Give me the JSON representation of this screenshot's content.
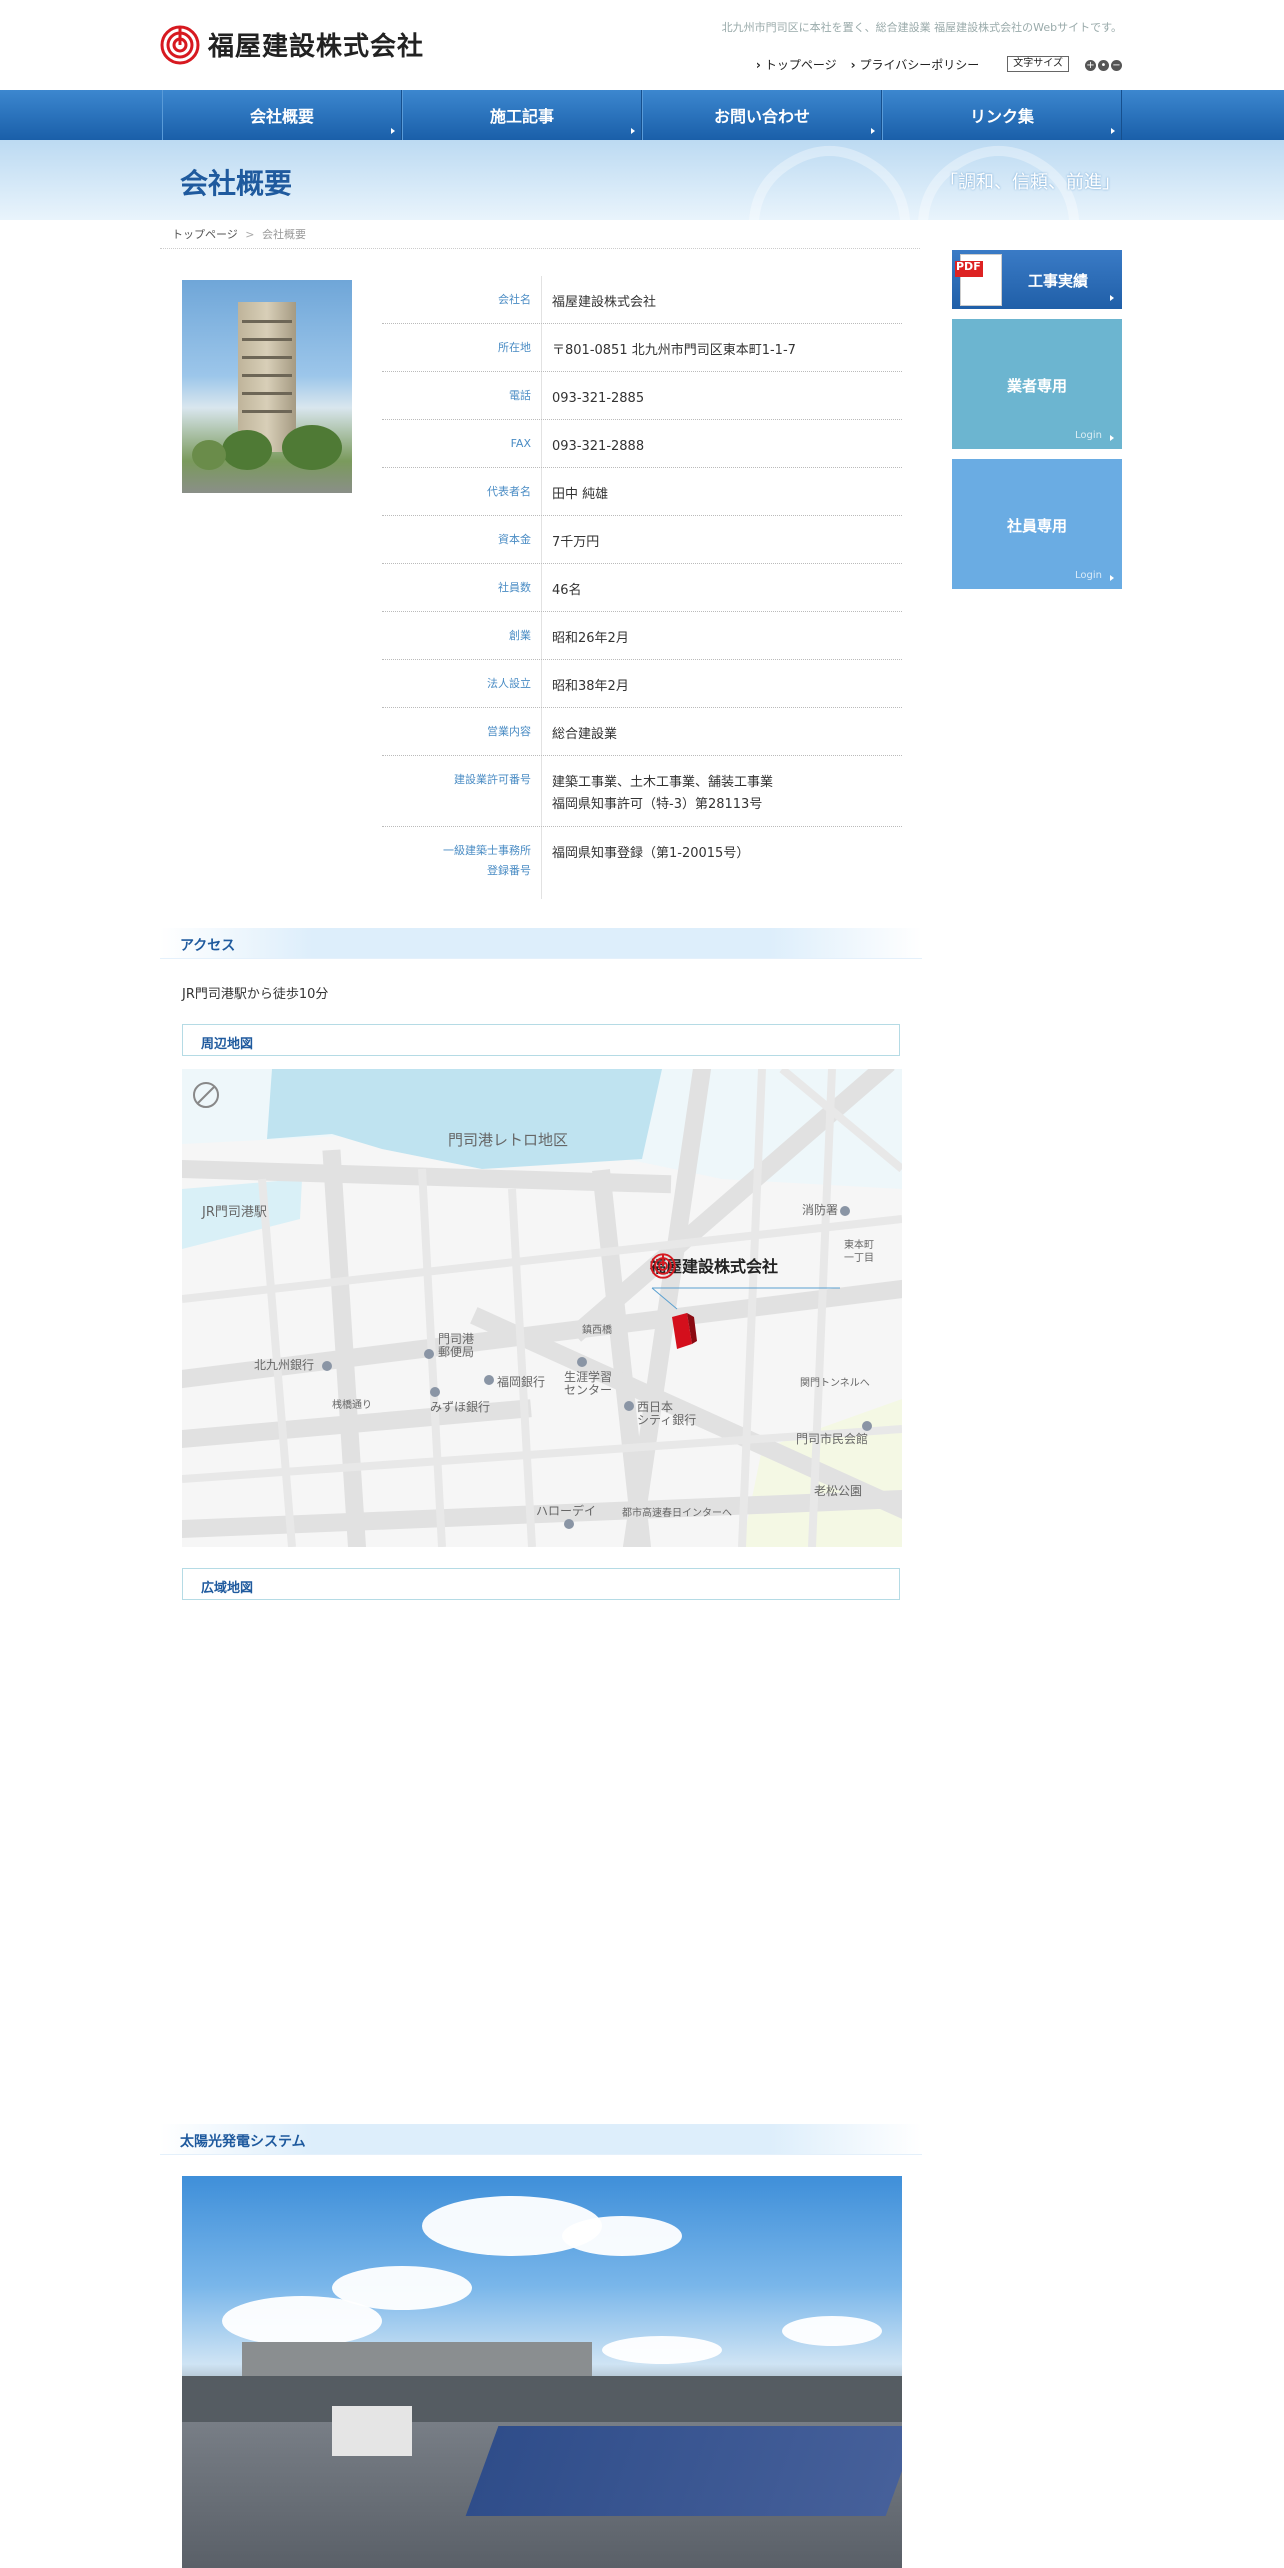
{
  "header": {
    "company_name": "福屋建設株式会社",
    "tagline": "北九州市門司区に本社を置く、総合建設業 福屋建設株式会社のWebサイトです。",
    "util_links": {
      "top": "トップページ",
      "privacy": "プライバシーポリシー"
    },
    "font_size_label": "文字サイズ",
    "font_size_controls": [
      "+",
      "•",
      "−"
    ]
  },
  "nav": {
    "items": [
      "会社概要",
      "施工記事",
      "お問い合わせ",
      "リンク集"
    ]
  },
  "title_band": {
    "title": "会社概要",
    "motto": "「調和、信頼、前進」"
  },
  "breadcrumb": {
    "home": "トップページ",
    "separator": ">",
    "current": "会社概要"
  },
  "company_info": [
    {
      "label": "会社名",
      "value": "福屋建設株式会社"
    },
    {
      "label": "所在地",
      "value": "〒801-0851 北九州市門司区東本町1-1-7"
    },
    {
      "label": "電話",
      "value": "093-321-2885"
    },
    {
      "label": "FAX",
      "value": "093-321-2888"
    },
    {
      "label": "代表者名",
      "value": "田中 純雄"
    },
    {
      "label": "資本金",
      "value": "7千万円"
    },
    {
      "label": "社員数",
      "value": "46名"
    },
    {
      "label": "創業",
      "value": "昭和26年2月"
    },
    {
      "label": "法人設立",
      "value": "昭和38年2月"
    },
    {
      "label": "営業内容",
      "value": "総合建設業"
    },
    {
      "label": "建設業許可番号",
      "value": "建築工事業、土木工事業、舗装工事業",
      "value2": "福岡県知事許可（特-3）第28113号"
    },
    {
      "label": "一級建築士事務所",
      "label2": "登録番号",
      "value": "福岡県知事登録（第1-20015号）"
    }
  ],
  "access": {
    "heading": "アクセス",
    "text": "JR門司港駅から徒歩10分",
    "nearby_map_title": "周辺地図",
    "wide_map_title": "広域地図"
  },
  "map": {
    "area_label": "門司港レトロ地区",
    "station": "JR門司港駅",
    "company_label": "福屋建設株式会社",
    "landmarks": {
      "fire": "消防署",
      "higashi1": "東本町",
      "higashi2": "一丁目",
      "kitakyu_bank": "北九州銀行",
      "sanbashi": "桟橋通り",
      "post1": "門司港",
      "post2": "郵便局",
      "mizuho": "みずほ銀行",
      "fukuoka_bank": "福岡銀行",
      "kinsai": "鎮西橋",
      "learn1": "生涯学習",
      "learn2": "センター",
      "nishi1": "西日本",
      "nishi2": "シティ銀行",
      "tunnel": "関門トンネルへ",
      "civic": "門司市民会館",
      "park": "老松公園",
      "hello": "ハローデイ",
      "highway": "都市高速春日インターへ"
    }
  },
  "solar": {
    "heading": "太陽光発電システム"
  },
  "sidebar": {
    "pdf_tag": "PDF",
    "works_label": "工事実績",
    "vendor_label": "業者専用",
    "staff_label": "社員専用",
    "login": "Login"
  },
  "colors": {
    "brand_blue": "#1f5a9e",
    "nav_blue": "#1a5fa9",
    "label_blue": "#4a8cc4",
    "logo_red": "#d71920"
  }
}
